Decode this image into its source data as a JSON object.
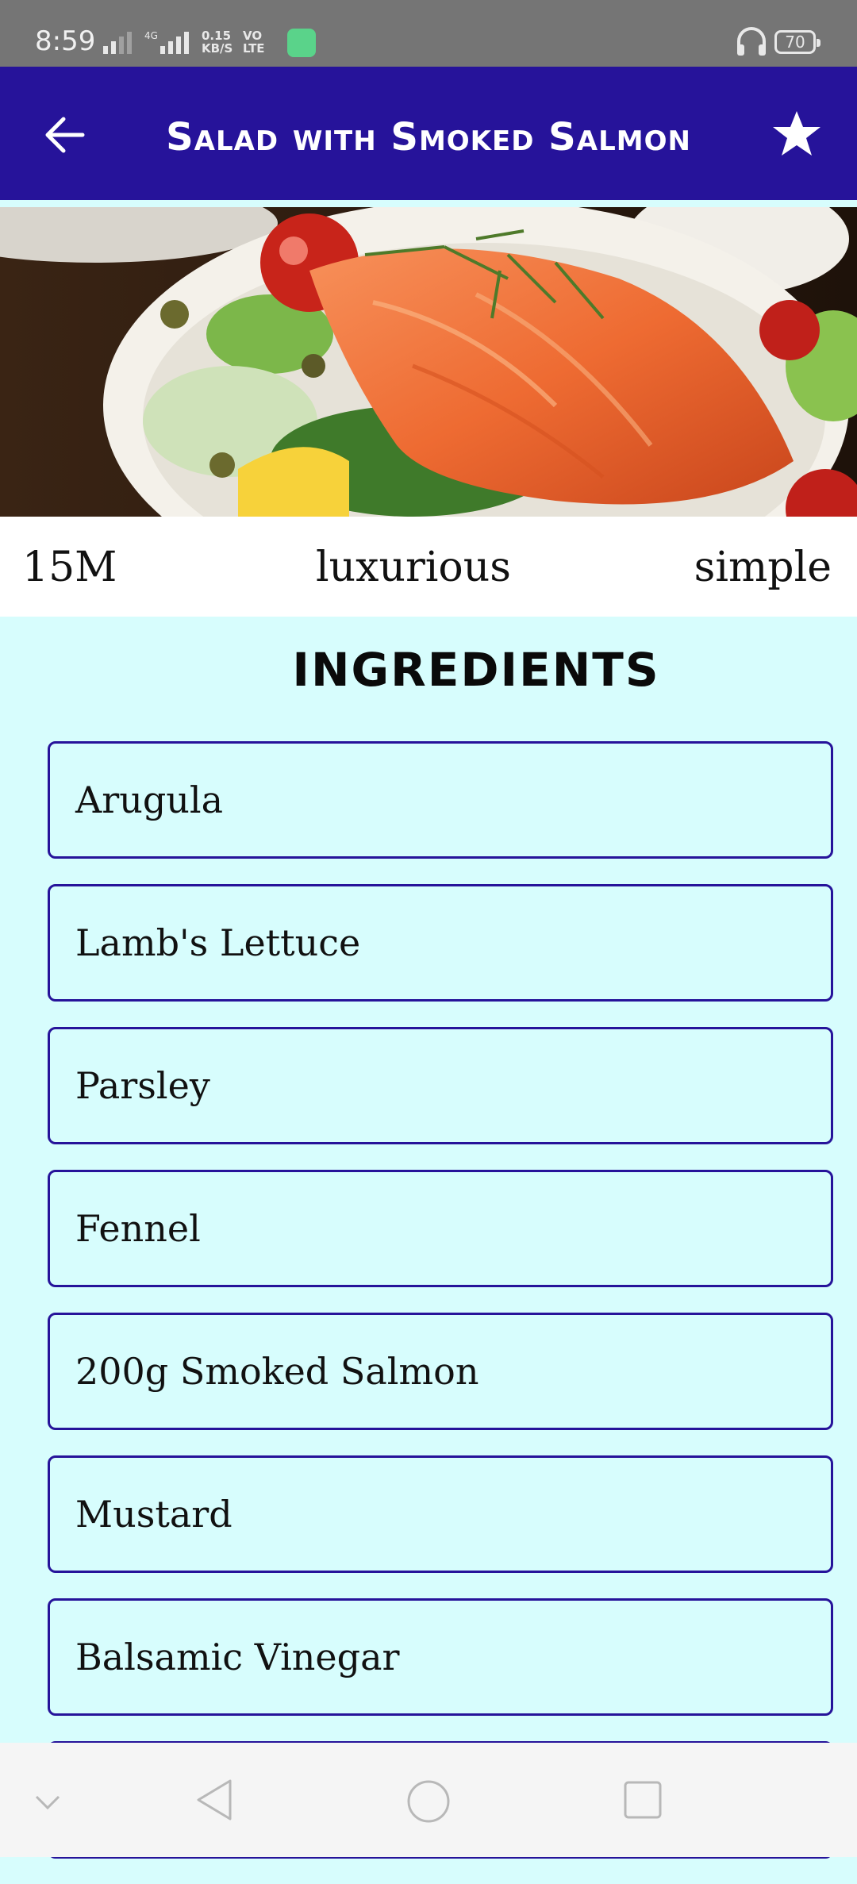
{
  "status_bar": {
    "time": "8:59",
    "net_speed": "0.15",
    "net_unit": "KB/S",
    "volte": "VO",
    "lte": "LTE",
    "battery": "70"
  },
  "header": {
    "title": "Salad with Smoked Salmon"
  },
  "meta": {
    "duration": "15M",
    "affordability": "luxurious",
    "complexity": "simple"
  },
  "ingredients": {
    "title": "INGREDIENTS",
    "items": [
      "Arugula",
      "Lamb's Lettuce",
      "Parsley",
      "Fennel",
      "200g Smoked Salmon",
      "Mustard",
      "Balsamic Vinegar"
    ]
  },
  "colors": {
    "app_bar": "#26139a",
    "background": "#d7fdfd",
    "card_border": "#26139a"
  }
}
